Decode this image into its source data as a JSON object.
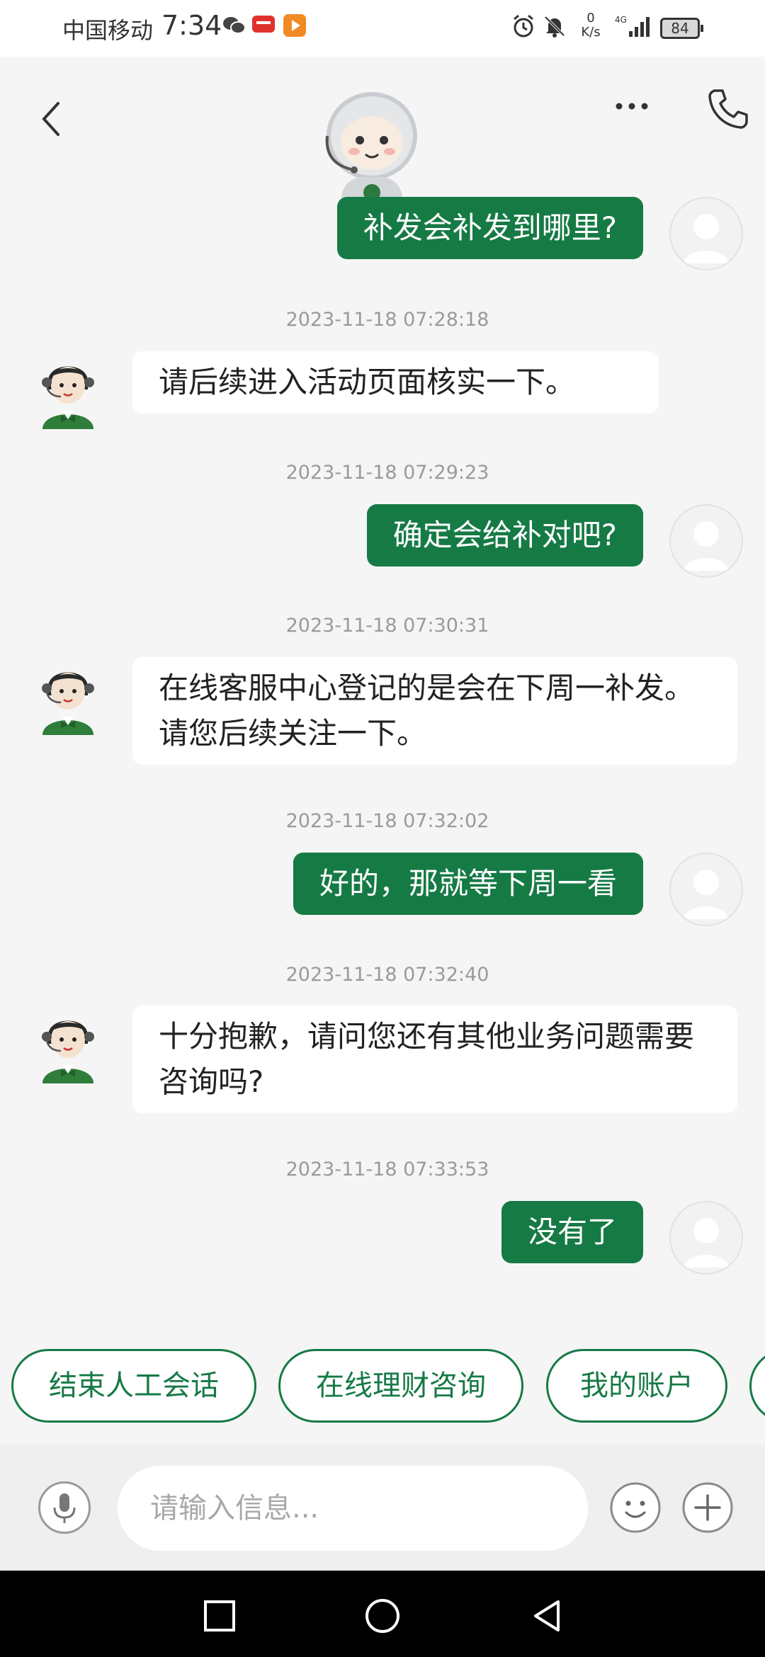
{
  "status_bar": {
    "carrier": "中国移动",
    "time": "7:34",
    "net_speed_value": "0",
    "net_speed_unit": "K/s",
    "network": "4G",
    "battery": "84",
    "icons": [
      "wechat-icon",
      "app-notification-icon",
      "video-app-icon",
      "alarm-icon",
      "mute-icon",
      "signal-icon",
      "battery-icon"
    ]
  },
  "header": {
    "back_icon": "chevron-left-icon",
    "more_icon": "more-dots-icon",
    "call_icon": "phone-icon",
    "mascot": "robot-mascot"
  },
  "messages": [
    {
      "type": "out",
      "text": "补发会补发到哪里?"
    },
    {
      "type": "time",
      "text": "2023-11-18 07:28:18"
    },
    {
      "type": "in",
      "text": "请后续进入活动页面核实一下。"
    },
    {
      "type": "time",
      "text": "2023-11-18 07:29:23"
    },
    {
      "type": "out",
      "text": "确定会给补对吧?"
    },
    {
      "type": "time",
      "text": "2023-11-18 07:30:31"
    },
    {
      "type": "in",
      "text": "在线客服中心登记的是会在下周一补发。请您后续关注一下。"
    },
    {
      "type": "time",
      "text": "2023-11-18 07:32:02"
    },
    {
      "type": "out",
      "text": "好的，那就等下周一看"
    },
    {
      "type": "time",
      "text": "2023-11-18 07:32:40"
    },
    {
      "type": "in",
      "text": "十分抱歉，请问您还有其他业务问题需要咨询吗?"
    },
    {
      "type": "time",
      "text": "2023-11-18 07:33:53"
    },
    {
      "type": "out",
      "text": "没有了"
    }
  ],
  "quick_replies": [
    "结束人工会话",
    "在线理财咨询",
    "我的账户"
  ],
  "input": {
    "placeholder": "请输入信息...",
    "value": "",
    "mic_icon": "microphone-icon",
    "emoji_icon": "emoji-icon",
    "plus_icon": "plus-icon"
  },
  "nav_bar": {
    "icons": [
      "recent-apps-icon",
      "home-icon",
      "back-triangle-icon"
    ]
  },
  "colors": {
    "accent": "#167a45",
    "page_bg": "#f5f5f5",
    "timestamp": "#9a9a9a",
    "bubble_in": "#ffffff"
  }
}
